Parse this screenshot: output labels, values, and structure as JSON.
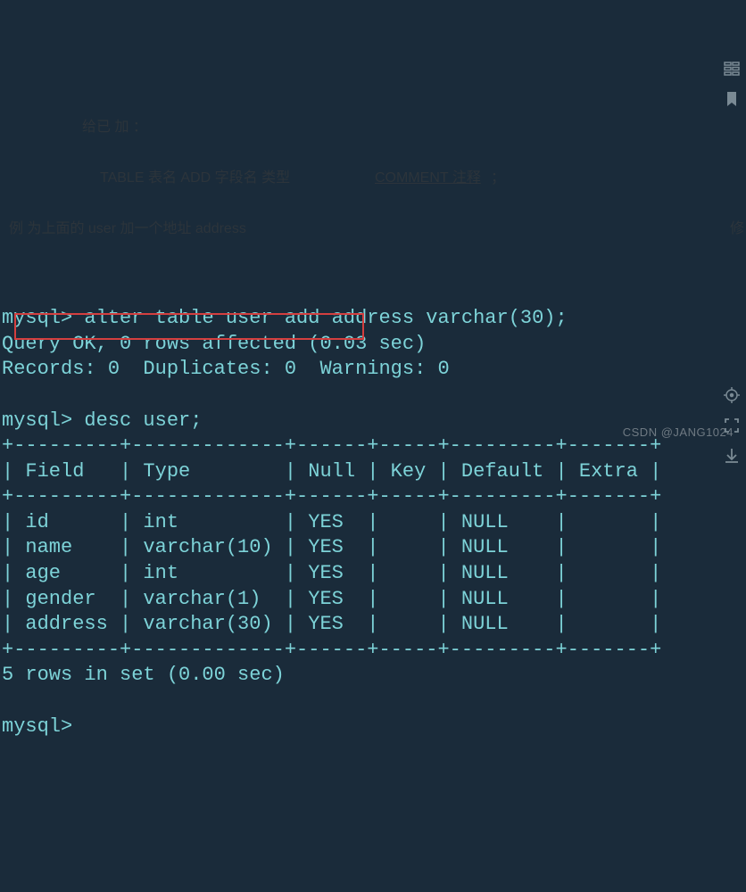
{
  "prompt": "mysql>",
  "cmd_alter": "alter table user add address varchar(30);",
  "result_line1": "Query OK, 0 rows affected (0.03 sec)",
  "result_line2": "Records: 0  Duplicates: 0  Warnings: 0",
  "cmd_desc": "desc user;",
  "border_top": "+---------+-------------+------+-----+---------+-------+",
  "header_line": "| Field   | Type        | Null | Key | Default | Extra |",
  "border_mid": "+---------+-------------+------+-----+---------+-------+",
  "table_rows": [
    "| id      | int         | YES  |     | NULL    |       |",
    "| name    | varchar(10) | YES  |     | NULL    |       |",
    "| age     | int         | YES  |     | NULL    |       |",
    "| gender  | varchar(1)  | YES  |     | NULL    |       |",
    "| address | varchar(30) | YES  |     | NULL    |       |"
  ],
  "border_bot": "+---------+-------------+------+-----+---------+-------+",
  "rows_summary": "5 rows in set (0.00 sec)",
  "ghost1": "给已    加    ：",
  "ghost2": "TABLE 表名 ADD 字段名 类型",
  "ghost3": "COMMENT 注释",
  "ghost4": "；",
  "ghost5": "例    为上面的 user    加一个地址 address",
  "ghost6": "修",
  "watermark": "CSDN @JANG1024"
}
